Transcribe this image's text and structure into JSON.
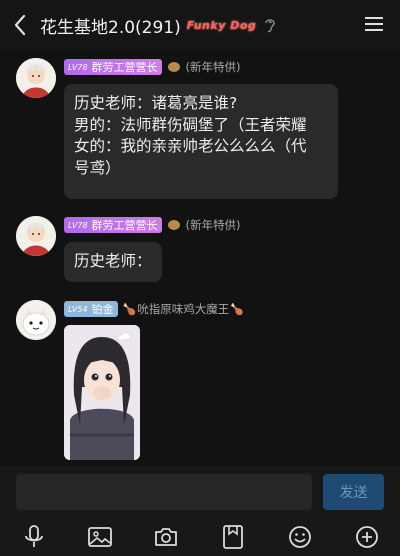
{
  "header": {
    "title": "花生基地2.0(291)",
    "tag": "Funky Dog"
  },
  "messages": [
    {
      "badge_level": "LV78",
      "badge_title": "群劳工营营长",
      "extra": "(新年特供)",
      "lines": [
        "历史老师：诸葛亮是谁?",
        "男的：法师群伤碉堡了（王者荣耀",
        "女的：我的亲亲帅老公么么么（代",
        "号鸢）"
      ]
    },
    {
      "badge_level": "LV78",
      "badge_title": "群劳工营营长",
      "extra": "(新年特供)",
      "lines": [
        "历史老师："
      ]
    },
    {
      "badge_level": "LV54",
      "badge_title": "铂金",
      "extra": "吮指原味鸡大魔王"
    }
  ],
  "input": {
    "placeholder": "",
    "send_label": "发送"
  },
  "toolbar": {
    "icons": [
      "microphone-icon",
      "image-icon",
      "camera-icon",
      "file-icon",
      "emoji-icon",
      "plus-icon"
    ]
  }
}
